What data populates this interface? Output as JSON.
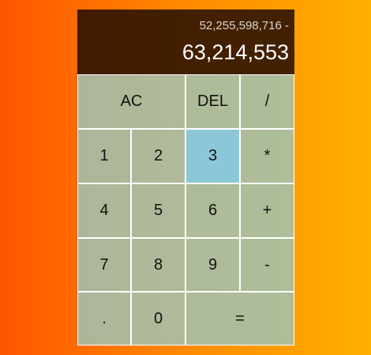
{
  "display": {
    "previous_operand": "52,255,598,716 -",
    "current_operand": "63,214,553"
  },
  "keys": {
    "ac": "AC",
    "del": "DEL",
    "divide": "/",
    "one": "1",
    "two": "2",
    "three": "3",
    "multiply": "*",
    "four": "4",
    "five": "5",
    "six": "6",
    "add": "+",
    "seven": "7",
    "eight": "8",
    "nine": "9",
    "subtract": "-",
    "decimal": ".",
    "zero": "0",
    "equals": "="
  },
  "colors": {
    "highlighted_key": "#8cc7d8",
    "display_background": "#281000"
  }
}
